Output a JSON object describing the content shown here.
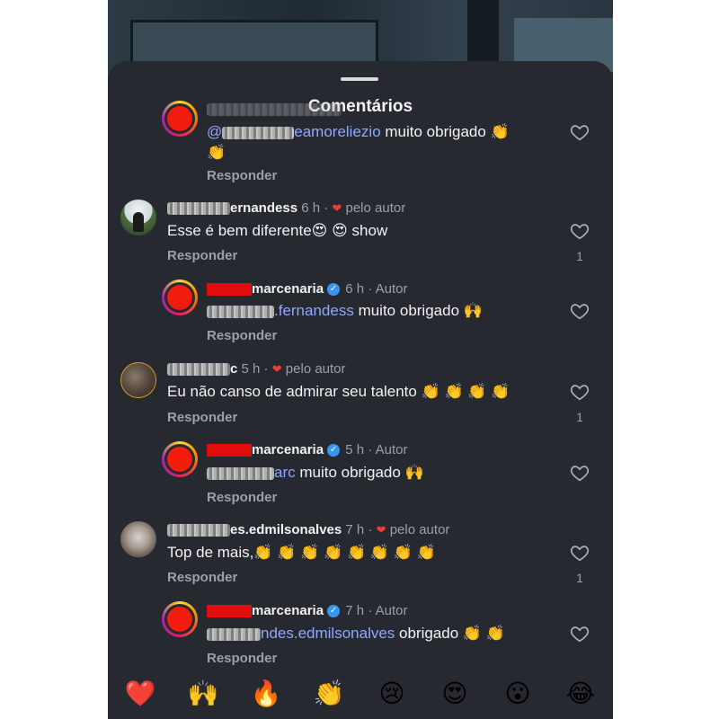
{
  "header": {
    "title": "Comentários"
  },
  "comments": [
    {
      "kind": "reply",
      "username_suffix": "",
      "time": "",
      "meta": "",
      "mention_suffix": "eamorelіezio",
      "text": " muito obrigado 👏",
      "text_line2": "👏",
      "reply_label": "Responder"
    },
    {
      "kind": "top",
      "username_suffix": "ernandess",
      "time": "6 h",
      "meta": "pelo autor",
      "text": "Esse é bem diferente😍 😍  show",
      "reply_label": "Responder",
      "likes": "1"
    },
    {
      "kind": "reply",
      "username_suffix": "marcenaria",
      "time": "6 h",
      "meta": "Autor",
      "mention_suffix": ".fernandess",
      "text": " muito obrigado 🙌",
      "reply_label": "Responder"
    },
    {
      "kind": "top",
      "username_suffix": "c",
      "time": "5 h",
      "meta": "pelo autor",
      "text": "Eu não canso de admirar seu talento 👏 👏 👏 👏",
      "reply_label": "Responder",
      "likes": "1"
    },
    {
      "kind": "reply",
      "username_suffix": "marcenaria",
      "time": "5 h",
      "meta": "Autor",
      "mention_suffix": "arc",
      "text": " muito obrigado 🙌",
      "reply_label": "Responder"
    },
    {
      "kind": "top",
      "username_suffix": "es.edmilsonalves",
      "time": "7 h",
      "meta": "pelo autor",
      "text": "Top de mais,👏 👏 👏 👏 👏 👏 👏 👏",
      "reply_label": "Responder",
      "likes": "1"
    },
    {
      "kind": "reply",
      "username_suffix": "marcenaria",
      "time": "7 h",
      "meta": "Autor",
      "mention_suffix": "ndes.edmilsonalves",
      "text": " obrigado 👏 👏",
      "reply_label": "Responder"
    }
  ],
  "reactions": [
    "❤️",
    "🙌",
    "🔥",
    "👏",
    "😢",
    "😍",
    "😮",
    "😂"
  ],
  "icons": {
    "like": "heart-outline-icon",
    "verified": "verified-badge-icon",
    "author_like": "heart-filled-icon"
  },
  "colors": {
    "sheet": "#262a30",
    "mention": "#8ea7ff",
    "verified": "#3797f0",
    "author_heart": "#f23b3b"
  }
}
